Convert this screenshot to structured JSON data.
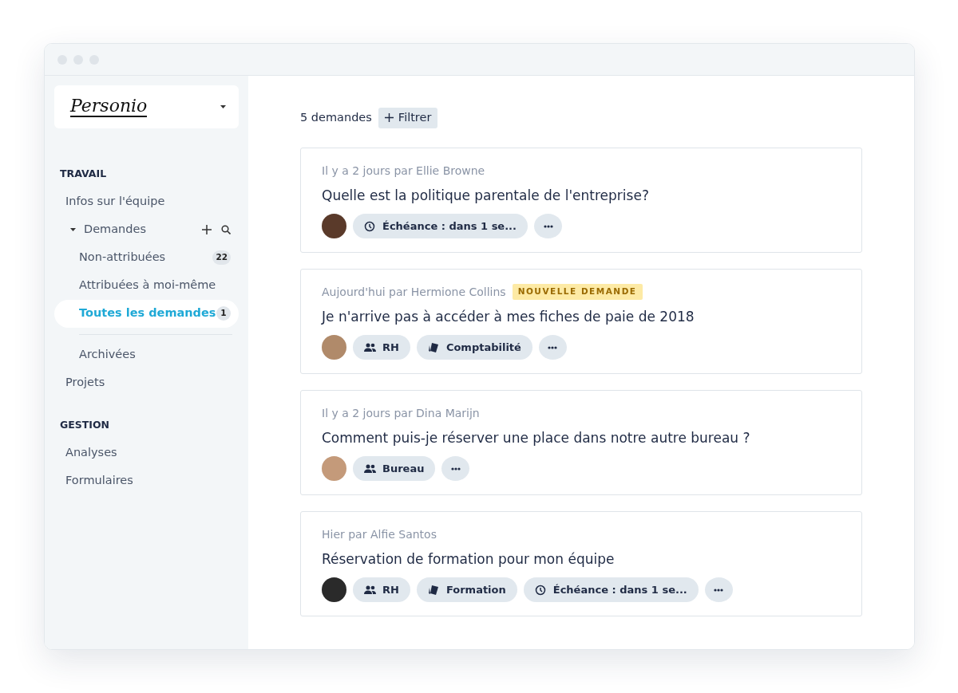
{
  "logo": {
    "text": "Personio"
  },
  "sidebar": {
    "sections": [
      {
        "heading": "TRAVAIL",
        "items": [
          {
            "label": "Infos sur l'équipe",
            "selected": false
          },
          {
            "label": "Demandes",
            "selected": false,
            "expanded": true,
            "children": [
              {
                "label": "Non-attribuées",
                "selected": false,
                "count": "22"
              },
              {
                "label": "Attribuées à moi-même",
                "selected": false
              },
              {
                "label": "Toutes les demandes",
                "selected": true,
                "count": "1",
                "divider_after": true
              },
              {
                "label": "Archivées",
                "selected": false
              }
            ]
          },
          {
            "label": "Projets",
            "selected": false
          }
        ]
      },
      {
        "heading": "GESTION",
        "items": [
          {
            "label": "Analyses",
            "selected": false
          },
          {
            "label": "Formulaires",
            "selected": false
          }
        ]
      }
    ]
  },
  "toolbar": {
    "count": "5 demandes",
    "filter_button": "Filtrer"
  },
  "requests": [
    {
      "meta": "Il y a 2 jours par Ellie Browne",
      "title": "Quelle est la politique parentale de l'entreprise?",
      "tags": [
        {
          "kind": "due",
          "label": "Échéance : dans 1 se..."
        }
      ]
    },
    {
      "meta": "Aujourd'hui par Hermione Collins",
      "badge": "NOUVELLE DEMANDE",
      "title": "Je n'arrive pas à accéder à mes fiches de paie de 2018",
      "tags": [
        {
          "kind": "team",
          "label": "RH"
        },
        {
          "kind": "category",
          "label": "Comptabilité"
        }
      ]
    },
    {
      "meta": "Il y a 2 jours par Dina Marijn",
      "title": "Comment puis-je réserver une place dans notre autre bureau ?",
      "tags": [
        {
          "kind": "team",
          "label": "Bureau"
        }
      ]
    },
    {
      "meta": "Hier par Alfie Santos",
      "title": "Réservation de formation pour mon équipe",
      "tags": [
        {
          "kind": "team",
          "label": "RH"
        },
        {
          "kind": "category",
          "label": "Formation"
        },
        {
          "kind": "due",
          "label": "Échéance : dans 1 se..."
        }
      ]
    }
  ]
}
